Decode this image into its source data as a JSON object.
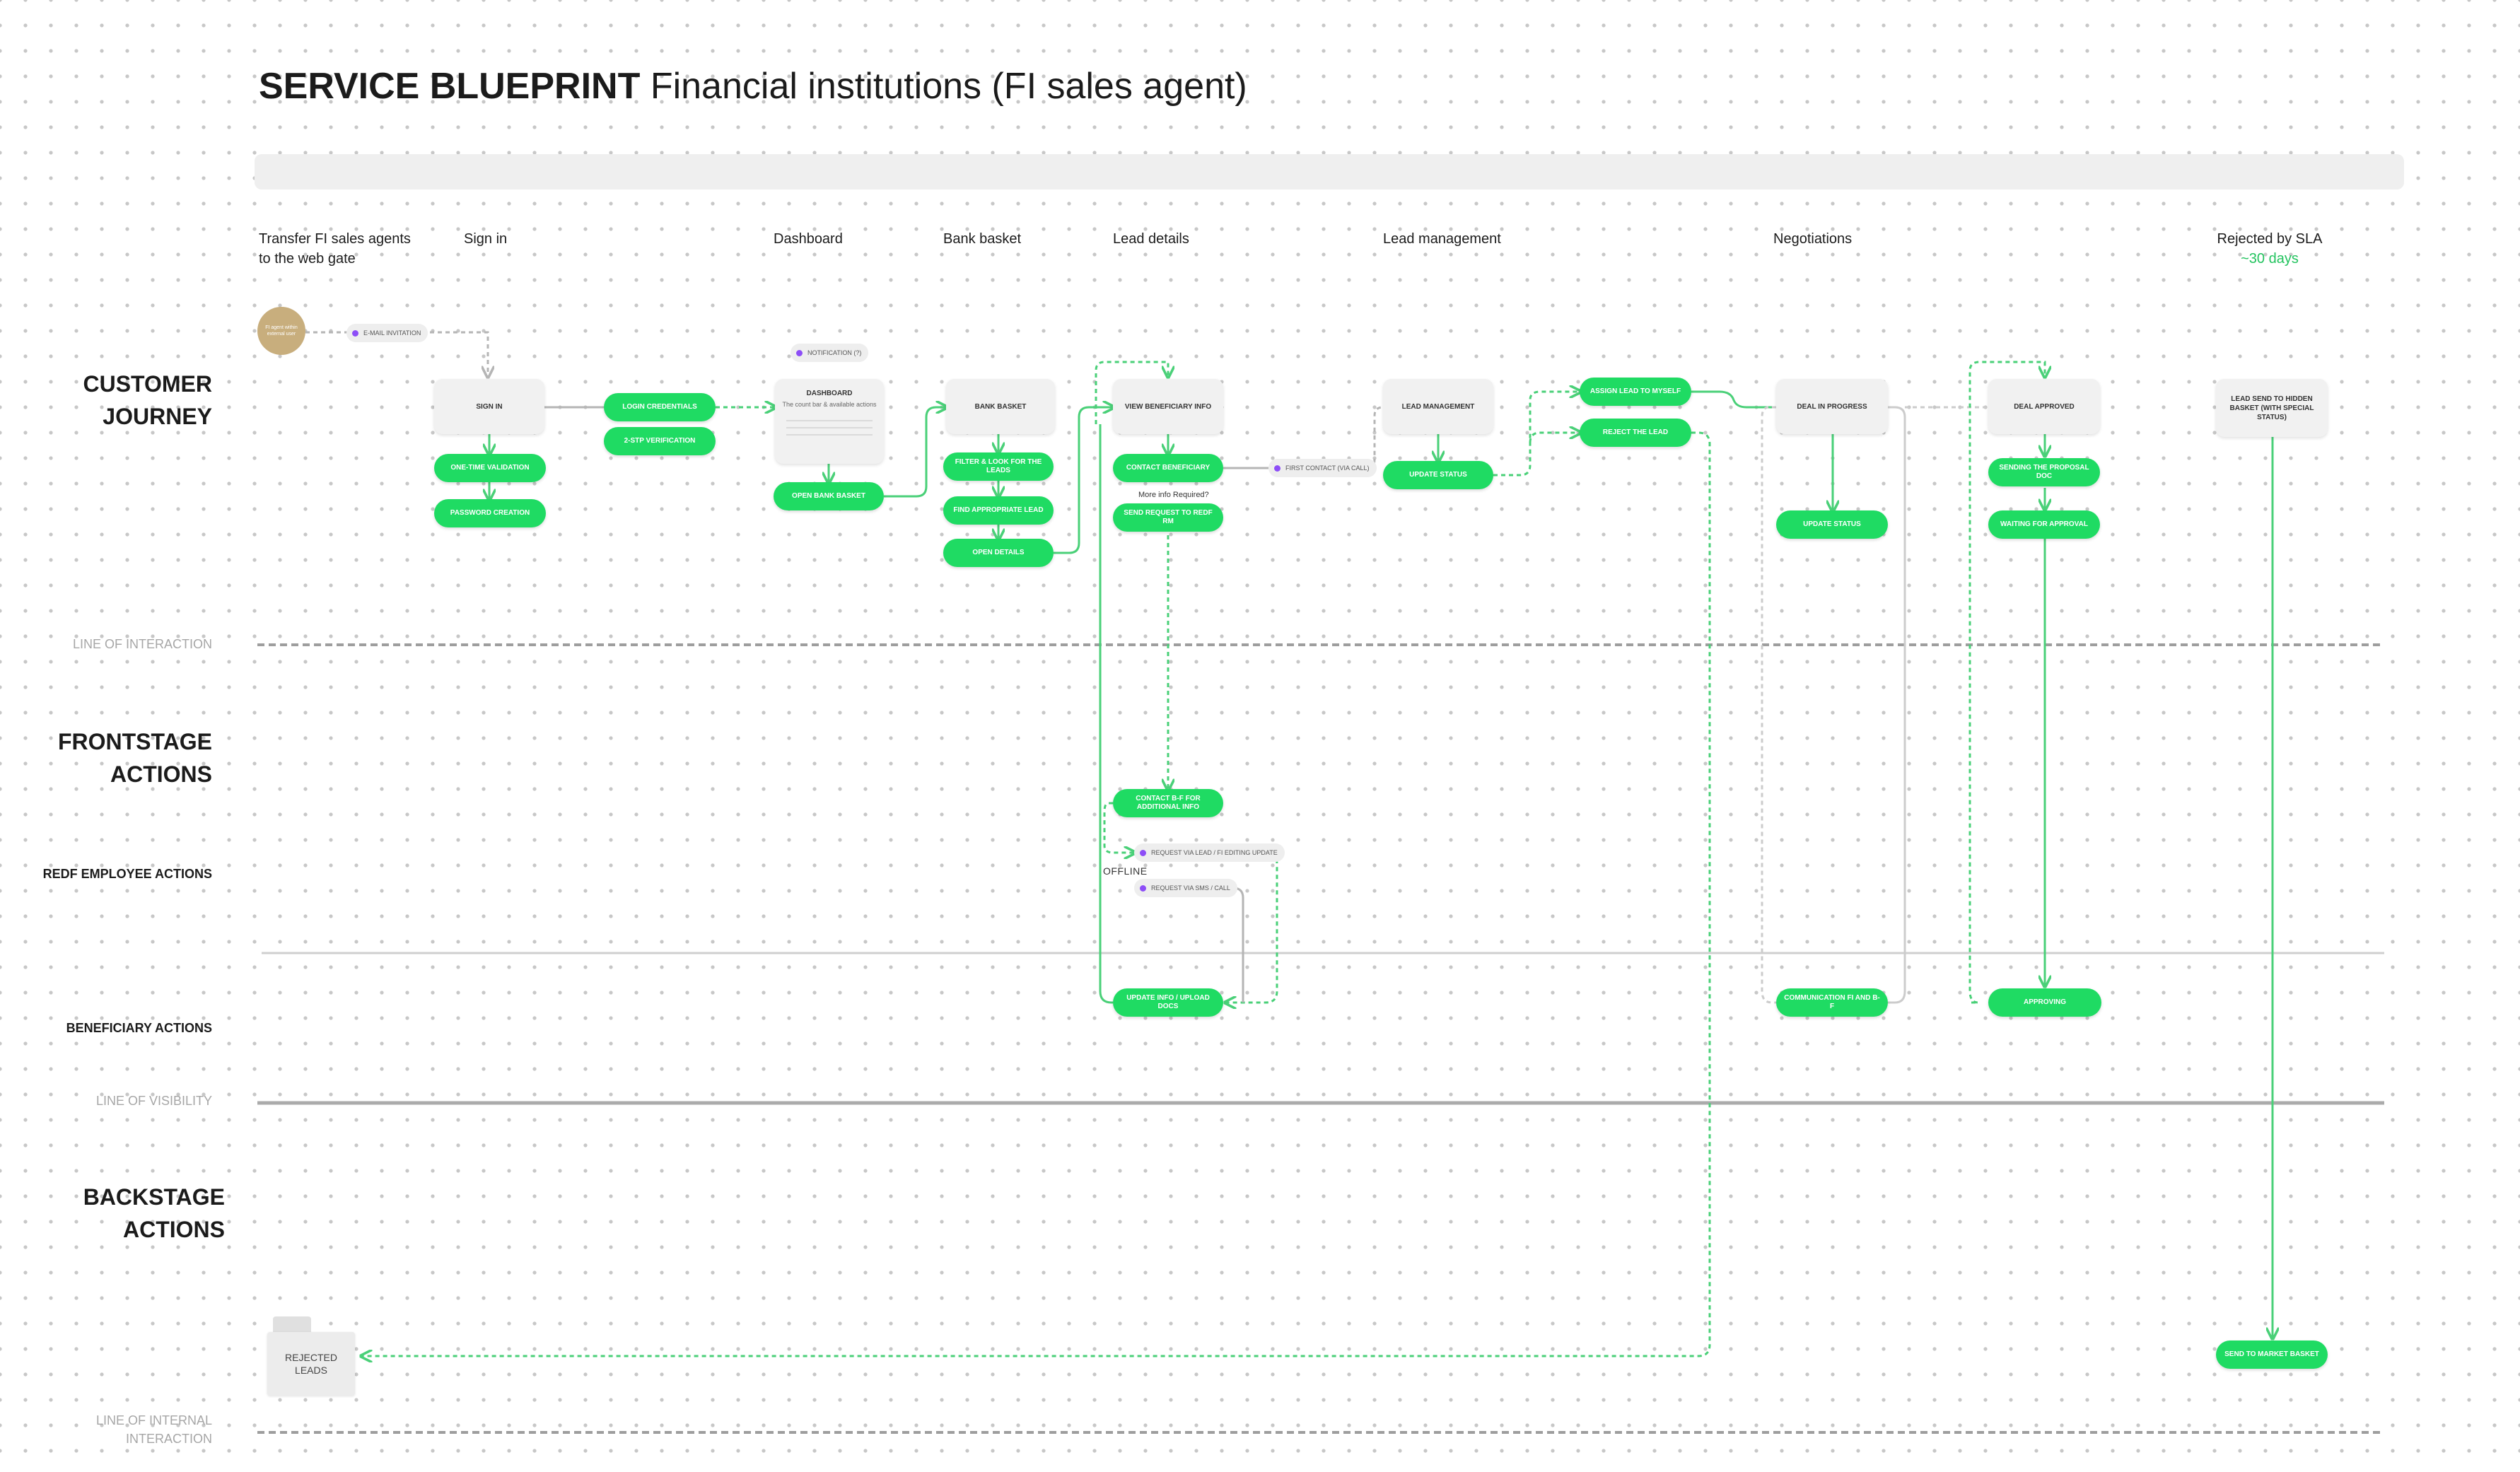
{
  "title": {
    "bold": "SERVICE BLUEPRINT",
    "rest": "Financial institutions (FI sales agent)"
  },
  "stages": {
    "transfer": [
      "Transfer FI sales agents",
      "to the web gate"
    ],
    "signin": "Sign in",
    "dashboard": "Dashboard",
    "bank_basket": "Bank basket",
    "lead_details": "Lead details",
    "lead_management": "Lead management",
    "negotiations": "Negotiations",
    "rejected_sla": "Rejected by SLA",
    "rejected_sla_days": "~30 days"
  },
  "lanes": {
    "customer_journey": [
      "CUSTOMER",
      "JOURNEY"
    ],
    "line_interaction": "LINE OF INTERACTION",
    "frontstage": [
      "FRONTSTAGE",
      "ACTIONS"
    ],
    "redf_employee": "REDF EMPLOYEE ACTIONS",
    "beneficiary": "BENEFICIARY ACTIONS",
    "line_visibility": "LINE OF VISIBILITY",
    "backstage": [
      "BACKSTAGE",
      "ACTIONS"
    ],
    "line_internal": [
      "LINE OF INTERNAL",
      "INTERACTION"
    ]
  },
  "avatar_text": "FI agent within external user",
  "chips": {
    "email_invitation": "E-MAIL INVITATION",
    "notification": "NOTIFICATION (?)",
    "first_contact": "FIRST CONTACT (VIA CALL)",
    "request_via_lead": "REQUEST VIA LEAD / FI EDITING UPDATE",
    "request_sms": "REQUEST VIA SMS / CALL"
  },
  "cards": {
    "sign_in": "SIGN IN",
    "dashboard": "DASHBOARD",
    "dashboard_sub": "The count bar & available actions",
    "bank_basket": "BANK BASKET",
    "view_beneficiary": "VIEW BENEFICIARY INFO",
    "lead_management": "LEAD MANAGEMENT",
    "deal_in_progress": "DEAL IN PROGRESS",
    "deal_approved": "DEAL APPROVED",
    "lead_send_hidden": "LEAD SEND TO HIDDEN BASKET (WITH SPECIAL STATUS)"
  },
  "pills": {
    "one_time_validation": "ONE-TIME VALIDATION",
    "password_creation": "PASSWORD CREATION",
    "login_credentials": "LOGIN CREDENTIALS",
    "two_step": "2-STP VERIFICATION",
    "open_bank_basket": "OPEN BANK BASKET",
    "filter_look": "FILTER & LOOK FOR THE LEADS",
    "find_lead": "FIND APPROPRIATE LEAD",
    "open_details": "OPEN DETAILS",
    "contact_beneficiary": "CONTACT BENEFICIARY",
    "send_request": "SEND REQUEST TO REDF RM",
    "update_status": "UPDATE STATUS",
    "assign_lead": "ASSIGN LEAD TO MYSELF",
    "reject_lead": "REJECT THE LEAD",
    "update_status_neg": "UPDATE STATUS",
    "sending_proposal": "SENDING THE PROPOSAL DOC",
    "waiting_approval": "WAITING FOR APPROVAL",
    "contact_bf": "CONTACT B-F FOR ADDITIONAL INFO",
    "update_info": "UPDATE INFO / UPLOAD DOCS",
    "communication": "COMMUNICATION FI AND B-F",
    "approving": "APPROVING",
    "send_market": "SEND TO MARKET BASKET"
  },
  "notes": {
    "more_info": "More info Required?",
    "offline": "OFFLINE"
  },
  "folder": "REJECTED LEADS",
  "colors": {
    "accent": "#1fdb63",
    "line": "#4ad078",
    "chip_dot": "#8d4ef7",
    "card": "#f1f1f1"
  }
}
